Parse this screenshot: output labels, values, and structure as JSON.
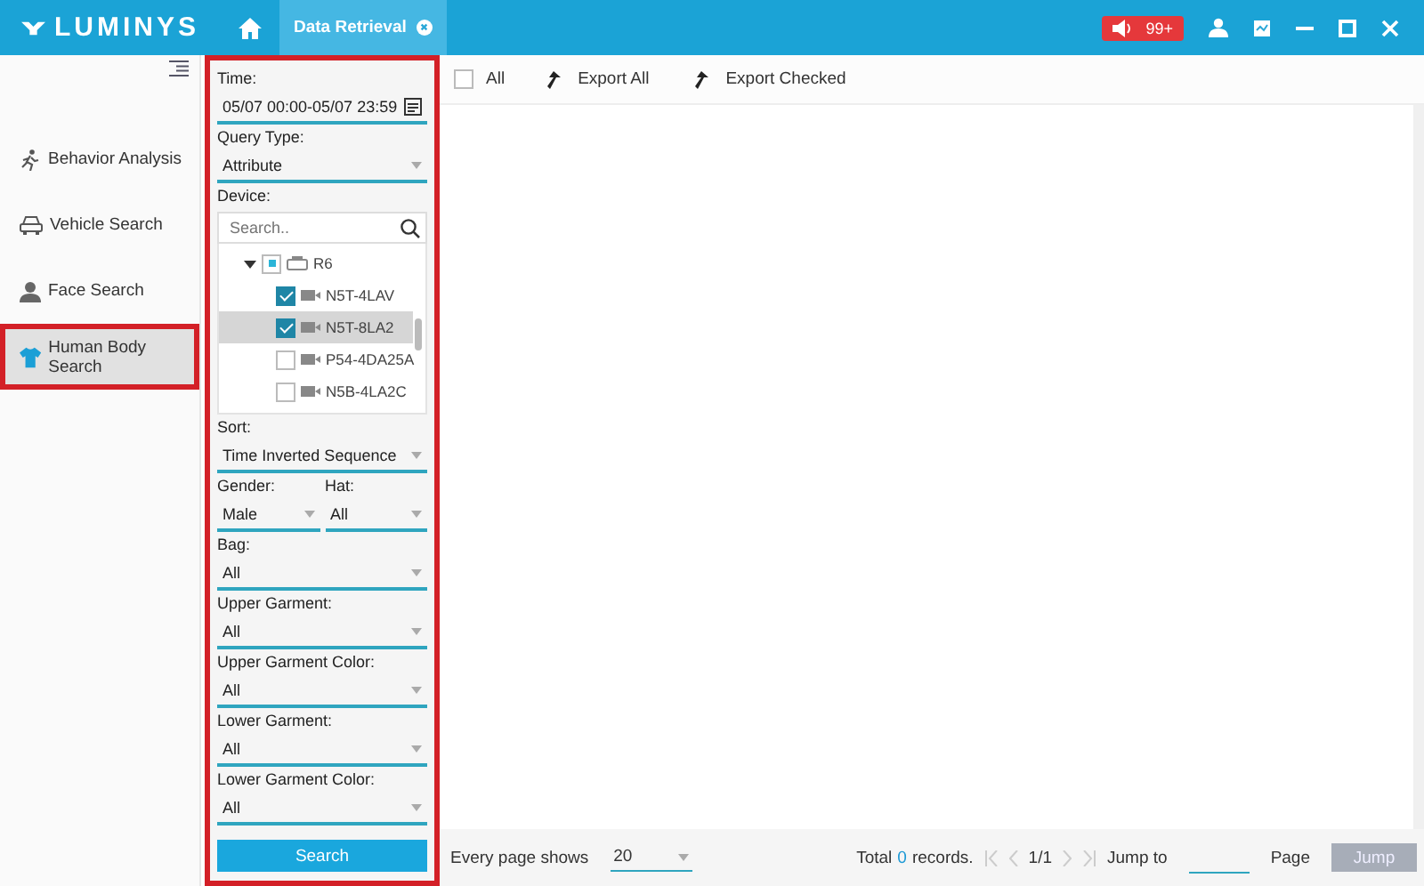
{
  "header": {
    "logo": "LUMINYS",
    "tabs": [
      {
        "label": "Data Retrieval",
        "selected": true
      }
    ],
    "alarm_count": "99+"
  },
  "sidebar": {
    "items": [
      {
        "label": "Behavior Analysis",
        "kind": "behavior",
        "selected": false
      },
      {
        "label": "Vehicle Search",
        "kind": "vehicle",
        "selected": false
      },
      {
        "label": "Face Search",
        "kind": "face",
        "selected": false
      },
      {
        "label": "Human Body Search",
        "kind": "body",
        "selected": true
      }
    ]
  },
  "filters": {
    "time": {
      "label": "Time:",
      "value": "05/07 00:00-05/07 23:59"
    },
    "query_type": {
      "label": "Query Type:",
      "value": "Attribute"
    },
    "device": {
      "label": "Device:",
      "placeholder": "Search..",
      "tree": [
        {
          "label": "R6",
          "expanded": true,
          "partial": true,
          "selected": false,
          "children": [
            {
              "label": "N5T-4LAV",
              "checked": true,
              "selected": false
            },
            {
              "label": "N5T-8LA2",
              "checked": true,
              "selected": true
            },
            {
              "label": "P54-4DA25A",
              "checked": false,
              "selected": false
            },
            {
              "label": "N5B-4LA2C",
              "checked": false,
              "selected": false
            }
          ]
        }
      ]
    },
    "selects": [
      {
        "label": "Sort:",
        "value": "Time Inverted Sequence",
        "kind": "full"
      },
      {
        "label": "Gender:",
        "value": "Male",
        "kind": "half"
      },
      {
        "label": "Hat:",
        "value": "All",
        "kind": "half"
      },
      {
        "label": "Bag:",
        "value": "All",
        "kind": "full"
      },
      {
        "label": "Upper Garment:",
        "value": "All",
        "kind": "full"
      },
      {
        "label": "Upper Garment Color:",
        "value": "All",
        "kind": "full"
      },
      {
        "label": "Lower Garment:",
        "value": "All",
        "kind": "full"
      },
      {
        "label": "Lower Garment Color:",
        "value": "All",
        "kind": "full"
      }
    ],
    "search_button": "Search"
  },
  "toolbar": {
    "all": {
      "label": "All",
      "checked": false
    },
    "buttons": [
      "Export All",
      "Export Checked"
    ]
  },
  "footer": {
    "page_size_label": "Every page shows",
    "page_size": "20",
    "total_prefix": "Total",
    "total_count": "0",
    "total_suffix": "records.",
    "pager": "1/1",
    "jump_label": "Jump to",
    "page_label": "Page",
    "jump_button": {
      "label": "Jump",
      "disabled": true
    }
  }
}
